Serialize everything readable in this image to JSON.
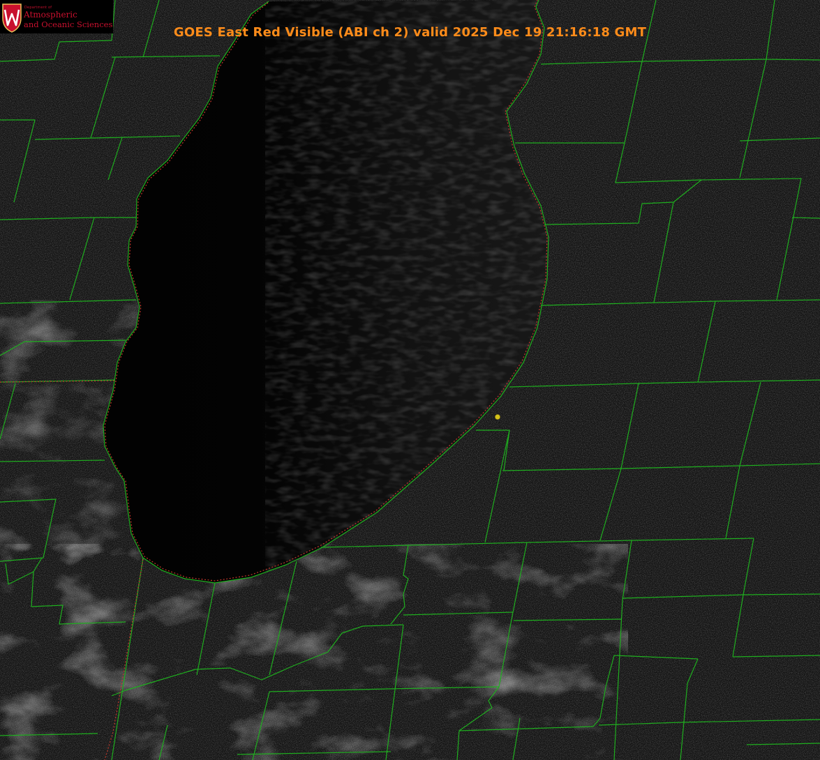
{
  "title": "GOES East Red Visible (ABI ch 2) valid 2025 Dec 19 21:16:18 GMT",
  "logo": {
    "department": "Department of",
    "line1": "Atmospheric",
    "line2": "and Oceanic Sciences"
  },
  "colors": {
    "title": "#ff8c1a",
    "county_lines": "#1fae1f",
    "state_line": "#c0392b",
    "marker": "#d4c21a",
    "brand": "#c8102e"
  },
  "layers": [
    "lake-michigan",
    "county-boundaries",
    "state-boundaries",
    "station-marker"
  ]
}
